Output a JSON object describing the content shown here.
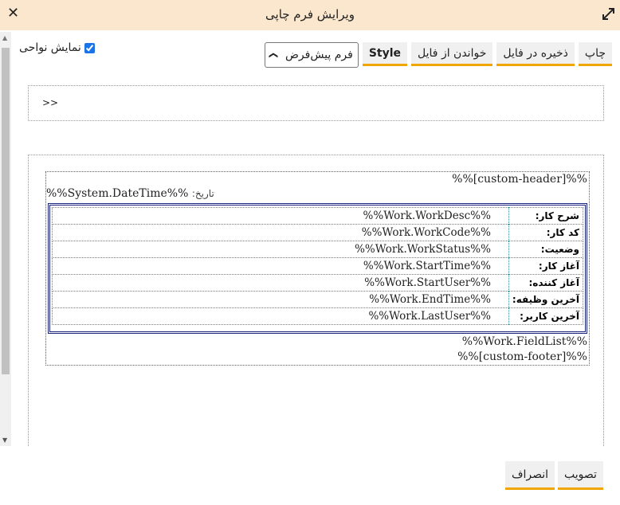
{
  "window": {
    "title": "ویرایش فرم چاپی"
  },
  "options": {
    "show_margins_label": "نمایش نواحی",
    "show_margins_checked": true
  },
  "toolbar": {
    "template_select": "فرم پیش‌فرض",
    "style_label": "Style",
    "load_label": "خواندن از فایل",
    "save_label": "ذخیره در فایل",
    "print_label": "چاپ"
  },
  "editor": {
    "breadcrumb": ">>",
    "header": "%%[custom-header]%%",
    "date_label": "تاریخ:",
    "date_value": "%%System.DateTime%%",
    "rows": [
      {
        "label": "شرح کار:",
        "value": "%%Work.WorkDesc%%"
      },
      {
        "label": "کد کار:",
        "value": "%%Work.WorkCode%%"
      },
      {
        "label": "وضعیت:",
        "value": "%%Work.WorkStatus%%"
      },
      {
        "label": "آغاز کار:",
        "value": "%%Work.StartTime%%"
      },
      {
        "label": "آغاز کننده:",
        "value": "%%Work.StartUser%%"
      },
      {
        "label": "آخرین وظیفه:",
        "value": "%%Work.EndTime%%"
      },
      {
        "label": "آخرین کاربر:",
        "value": "%%Work.LastUser%%"
      }
    ],
    "field_list": "%%Work.FieldList%%",
    "footer": "%%[custom-footer]%%"
  },
  "actions": {
    "approve_label": "تصویب",
    "cancel_label": "انصراف"
  },
  "colors": {
    "titlebar": "#fae7cd",
    "accent": "#f0a500",
    "table_border": "#1a237e"
  }
}
